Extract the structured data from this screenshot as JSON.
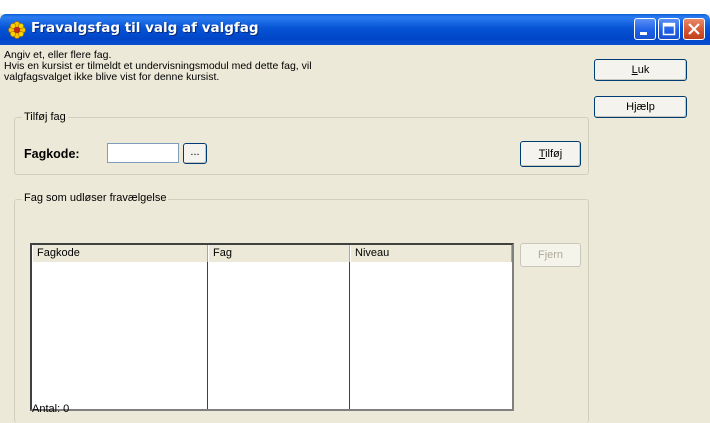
{
  "window": {
    "title": "Fravalgsfag til valg af valgfag"
  },
  "description": {
    "line1": "Angiv et, eller flere fag.",
    "line2": "Hvis en kursist er tilmeldt et undervisningsmodul med dette fag, vil",
    "line3": "valgfagsvalget ikke blive vist for denne kursist."
  },
  "buttons": {
    "close_mnemonic": "L",
    "close_rest": "uk",
    "help_pre": "H",
    "help_mnemonic": "j",
    "help_rest": "ælp",
    "add_mnemonic": "T",
    "add_rest": "ilføj",
    "remove": "Fjern",
    "browse": "..."
  },
  "add_group": {
    "legend": "Tilføj fag",
    "fagkode_label": "Fagkode:",
    "fagkode_value": ""
  },
  "list_group": {
    "legend": "Fag som udløser fravælgelse",
    "columns": [
      "Fagkode",
      "Fag",
      "Niveau"
    ],
    "rows": [],
    "count_label": "Antal: 0"
  }
}
